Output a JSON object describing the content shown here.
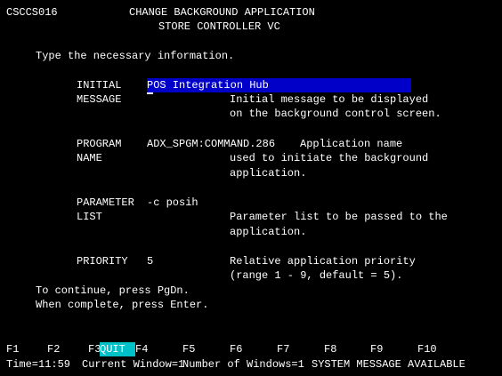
{
  "header": {
    "screen_id": "CSCCS016",
    "title": "CHANGE BACKGROUND APPLICATION",
    "subtitle": "STORE CONTROLLER VC"
  },
  "instruction": "Type the necessary information.",
  "fields": {
    "initial_message": {
      "label1": "INITIAL",
      "label2": "MESSAGE",
      "value_first": "P",
      "value_rest": "OS Integration Hub",
      "desc1": "Initial message to be displayed",
      "desc2": "on the background control screen."
    },
    "program_name": {
      "label1": "PROGRAM",
      "label2": "NAME",
      "value": "ADX_SPGM:COMMAND.286",
      "desc1": "Application name",
      "desc2": "used to initiate the background",
      "desc3": "application."
    },
    "parameter_list": {
      "label1": "PARAMETER",
      "label2": "LIST",
      "value": "-c posih",
      "desc1": "Parameter list to be passed to the",
      "desc2": "application."
    },
    "priority": {
      "label": "PRIORITY",
      "value": "5",
      "desc1": "Relative application priority",
      "desc2": "(range 1 - 9, default = 5)."
    }
  },
  "footer_help": {
    "line1": "To continue, press PgDn.",
    "line2": "When complete, press Enter."
  },
  "function_keys": {
    "f1": "F1",
    "f2": "F2",
    "f3": "F3",
    "f3_action": "QUIT",
    "f4": "F4",
    "f5": "F5",
    "f6": "F6",
    "f7": "F7",
    "f8": "F8",
    "f9": "F9",
    "f10": "F10"
  },
  "status_bar": {
    "time": "Time=11:59",
    "current_window": "Current Window=1",
    "num_windows": "Number of Windows=1",
    "message": "SYSTEM MESSAGE AVAILABLE"
  },
  "colors": {
    "background": "#000000",
    "text": "#ffffff",
    "field_highlight": "#0000c8",
    "quit_highlight": "#00c0c8"
  }
}
